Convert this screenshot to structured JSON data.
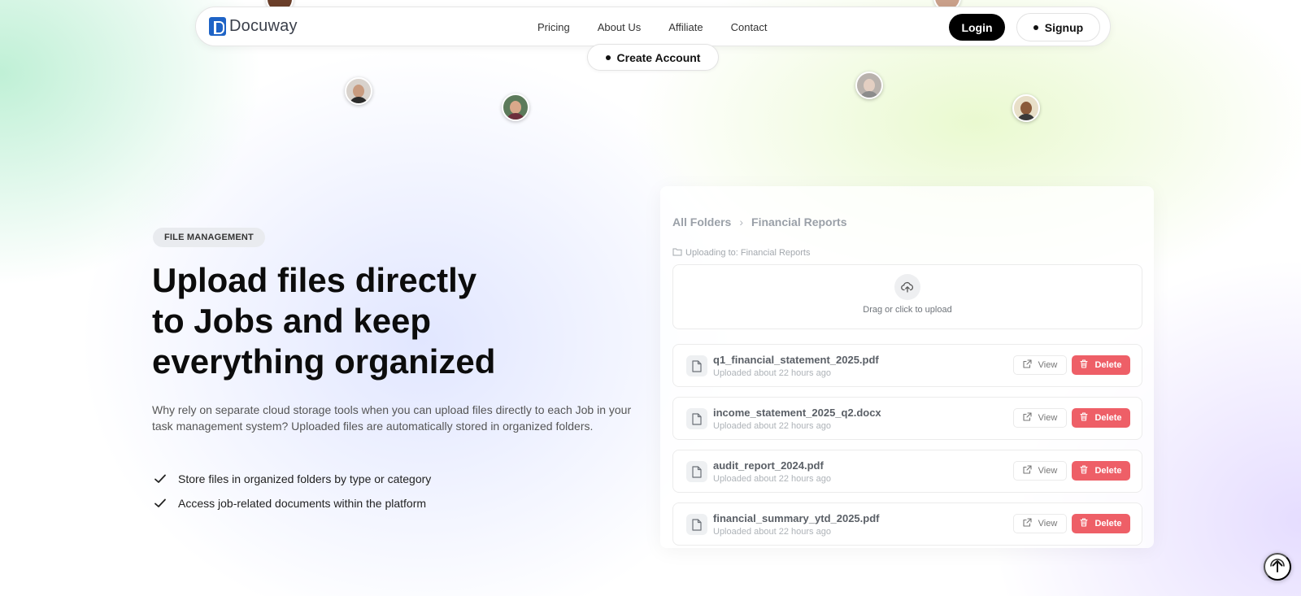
{
  "brand": {
    "name": "Docuway",
    "accent": "#1e63c6"
  },
  "nav": {
    "links": [
      "Pricing",
      "About Us",
      "Affiliate",
      "Contact"
    ],
    "login_label": "Login",
    "signup_label": "Signup",
    "create_account_label": "Create Account"
  },
  "hero": {
    "badge": "FILE MANAGEMENT",
    "headline_lines": [
      "Upload files directly",
      "to Jobs and keep",
      "everything organized"
    ],
    "description": "Why rely on separate cloud storage tools when you can upload files directly to each Job in your task management system? Uploaded files are automatically stored in organized folders.",
    "features": [
      "Store files in organized folders by type or category",
      "Access job-related documents within the platform"
    ]
  },
  "panel": {
    "breadcrumb": [
      "All Folders",
      "Financial Reports"
    ],
    "uploading_to": "Uploading to: Financial Reports",
    "dropzone_text": "Drag or click to upload",
    "view_label": "View",
    "delete_label": "Delete",
    "delete_color": "#ee5f67",
    "files": [
      {
        "name": "q1_financial_statement_2025.pdf",
        "meta": "Uploaded about 22 hours ago"
      },
      {
        "name": "income_statement_2025_q2.docx",
        "meta": "Uploaded about 22 hours ago"
      },
      {
        "name": "audit_report_2024.pdf",
        "meta": "Uploaded about 22 hours ago"
      },
      {
        "name": "financial_summary_ytd_2025.pdf",
        "meta": "Uploaded about 22 hours ago"
      }
    ]
  }
}
